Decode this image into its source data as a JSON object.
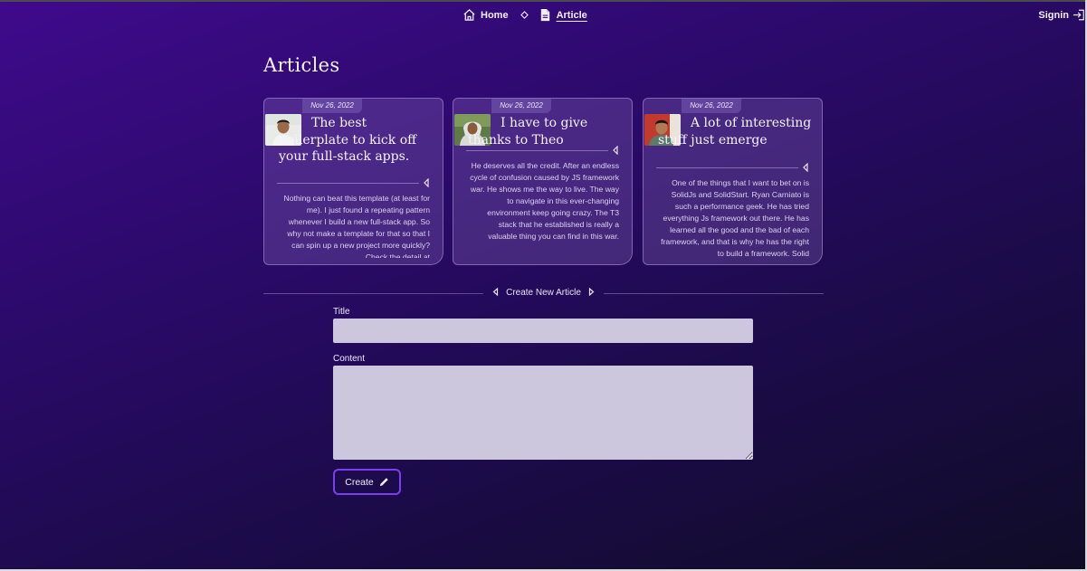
{
  "nav": {
    "home_label": "Home",
    "article_label": "Article",
    "signin_label": "Signin"
  },
  "page": {
    "title": "Articles"
  },
  "articles": [
    {
      "date": "Nov 26, 2022",
      "title": "The best boilerplate to kick off your full-stack apps.",
      "excerpt": "Nothing can beat this template (at least for me). I just found a repeating pattern whenever I build a new full-stack app. So why not make a template for that so that I can spin up a new project more quickly? Check the detail at"
    },
    {
      "date": "Nov 26, 2022",
      "title": "I have to give thanks to Theo",
      "excerpt": "He deserves all the credit. After an endless cycle of confusion caused by JS framework war. He shows me the way to live. The way to navigate in this ever-changing environment keep going crazy. The T3 stack that he established is really a valuable thing you can find in this war."
    },
    {
      "date": "Nov 26, 2022",
      "title": "A lot of interesting stuff just emerge",
      "excerpt": "One of the things that I want to bet on is SolidJs and SolidStart. Ryan Carniato is such a performance geek. He has tried everything Js framework out there. He has learned all the good and the bad of each framework, and that is why he has the right to build a framework. Solid"
    }
  ],
  "form": {
    "section_label": "Create New Article",
    "title_label": "Title",
    "title_value": "",
    "content_label": "Content",
    "content_value": "",
    "submit_label": "Create"
  },
  "icons": {
    "home": "home-icon",
    "article": "document-icon",
    "separator": "diamond-icon",
    "signin": "login-icon",
    "collapse": "caret-left-icon",
    "create": "pencil-icon"
  },
  "colors": {
    "accent": "#7a3ef0",
    "input_bg": "#cdc7dd"
  }
}
